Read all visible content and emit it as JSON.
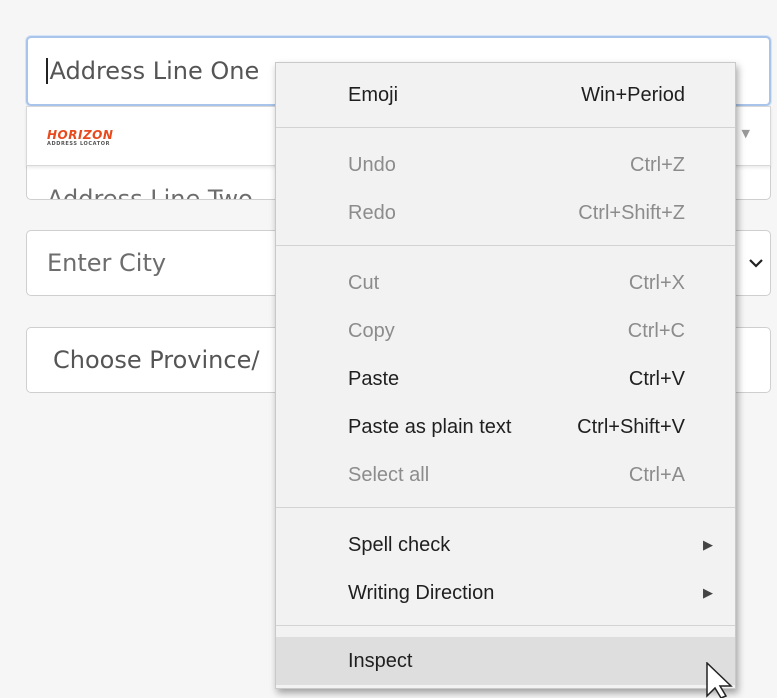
{
  "form": {
    "address_line_one_placeholder": "Address Line One",
    "address_line_two_placeholder": "Address Line Two",
    "city_placeholder": "Enter City",
    "province_label": "Choose Province/"
  },
  "suggestion": {
    "logo_text": "HORIZON",
    "logo_subtext": "ADDRESS LOCATOR",
    "logo_color": "#e8491d"
  },
  "context_menu": {
    "items": [
      {
        "label": "Emoji",
        "shortcut": "Win+Period",
        "enabled": true
      },
      {
        "label": "Undo",
        "shortcut": "Ctrl+Z",
        "enabled": false
      },
      {
        "label": "Redo",
        "shortcut": "Ctrl+Shift+Z",
        "enabled": false
      },
      {
        "label": "Cut",
        "shortcut": "Ctrl+X",
        "enabled": false
      },
      {
        "label": "Copy",
        "shortcut": "Ctrl+C",
        "enabled": false
      },
      {
        "label": "Paste",
        "shortcut": "Ctrl+V",
        "enabled": true
      },
      {
        "label": "Paste as plain text",
        "shortcut": "Ctrl+Shift+V",
        "enabled": true
      },
      {
        "label": "Select all",
        "shortcut": "Ctrl+A",
        "enabled": false
      },
      {
        "label": "Spell check",
        "submenu": true,
        "enabled": true
      },
      {
        "label": "Writing Direction",
        "submenu": true,
        "enabled": true
      },
      {
        "label": "Inspect",
        "enabled": true,
        "highlighted": true
      }
    ]
  }
}
